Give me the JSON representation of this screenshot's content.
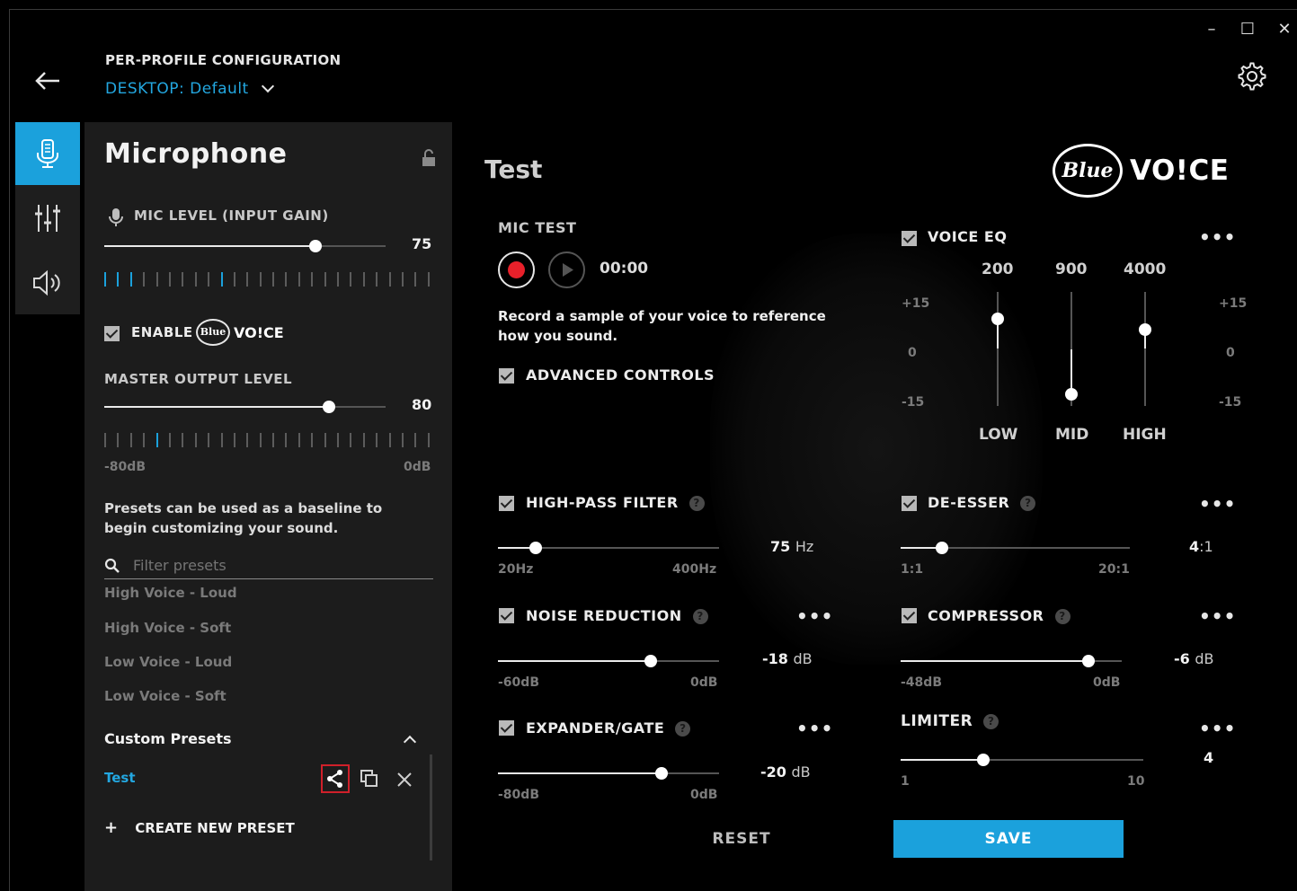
{
  "header": {
    "title": "PER-PROFILE CONFIGURATION",
    "profile_label": "DESKTOP: Default"
  },
  "window": {
    "minimize": "–",
    "maximize": "☐",
    "close": "✕"
  },
  "panel": {
    "title": "Microphone",
    "mic_level_label": "MIC LEVEL (INPUT GAIN)",
    "mic_level_value": "75",
    "mic_level": 75,
    "enable_label": "ENABLE",
    "blue_small": "Blue",
    "voice_small": "VO!CE",
    "master_output_label": "MASTER OUTPUT LEVEL",
    "master_output_value": "80",
    "master_output": 80,
    "scale_min": "-80dB",
    "scale_max": "0dB",
    "presets_description": "Presets can be used as a baseline to begin customizing your sound.",
    "filter_placeholder": "Filter presets",
    "presets": [
      "High Voice - Loud",
      "High Voice - Soft",
      "Low Voice - Loud",
      "Low Voice - Soft"
    ],
    "custom_presets_label": "Custom Presets",
    "custom_preset_name": "Test",
    "create_preset_label": "CREATE NEW PRESET"
  },
  "main": {
    "title": "Test",
    "logo_blue": "Blue",
    "logo_voice": "VO!CE",
    "mic_test_label": "MIC TEST",
    "timer": "00:00",
    "mic_test_description": "Record a sample of your voice to reference how you sound.",
    "advanced_controls_label": "ADVANCED CONTROLS",
    "voice_eq": {
      "label": "VOICE EQ",
      "freqs": [
        "200",
        "900",
        "4000"
      ],
      "bands": [
        "LOW",
        "MID",
        "HIGH"
      ],
      "gains": [
        8,
        -12,
        5
      ],
      "scale_top": "+15",
      "scale_mid": "0",
      "scale_bottom": "-15"
    },
    "high_pass": {
      "label": "HIGH-PASS FILTER",
      "value": "75",
      "unit": "Hz",
      "min": "20Hz",
      "max": "400Hz",
      "fraction": 0.17
    },
    "de_esser": {
      "label": "DE-ESSER",
      "value": "4",
      "unit": ":1",
      "min": "1:1",
      "max": "20:1",
      "fraction": 0.18
    },
    "noise_reduction": {
      "label": "NOISE REDUCTION",
      "value": "-18",
      "unit": "dB",
      "min": "-60dB",
      "max": "0dB",
      "fraction": 0.69
    },
    "compressor": {
      "label": "COMPRESSOR",
      "value": "-6",
      "unit": "dB",
      "min": "-48dB",
      "max": "0dB",
      "fraction": 0.85
    },
    "expander": {
      "label": "EXPANDER/GATE",
      "value": "-20",
      "unit": "dB",
      "min": "-80dB",
      "max": "0dB",
      "fraction": 0.74
    },
    "limiter": {
      "label": "LIMITER",
      "value": "4",
      "min": "1",
      "max": "10",
      "fraction": 0.34
    },
    "help_glyph": "?",
    "more_glyph": "•••",
    "reset_label": "RESET",
    "save_label": "SAVE"
  },
  "colors": {
    "accent": "#1ba1dc",
    "record": "#e8202a"
  }
}
